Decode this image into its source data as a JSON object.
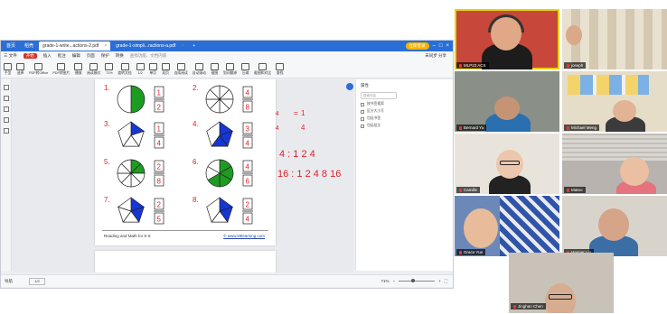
{
  "app": {
    "tabs": [
      {
        "label": "首页",
        "active": false
      },
      {
        "label": "稻壳",
        "active": false
      },
      {
        "label": "grade-1-write...actions-2.pdf",
        "active": true
      },
      {
        "label": "grade-1-simpli...ractions-a.pdf",
        "active": false
      }
    ],
    "new_tab": "+",
    "login_pill": "立即登录",
    "menu": [
      "三 文件",
      "开始",
      "插入",
      "批注",
      "编辑",
      "页面",
      "保护",
      "转换",
      "查找功能、文档内容"
    ],
    "menu_active_index": 1,
    "menu_right": "未同步  分享",
    "tools": [
      "手型",
      "选择",
      "PDF转Office",
      "PDF转图片",
      "播放",
      "阅读模式",
      "旋转文档",
      "单页",
      "双页",
      "连续阅读",
      "自动滚动",
      "截图",
      "划词翻译",
      "压缩",
      "截图和对比",
      "查找",
      "缩放"
    ],
    "zoom_value": "71%",
    "page_indicator": "1/2"
  },
  "document": {
    "footer_left": "Reading and Math for K-5",
    "footer_right": "© www.k5learning.com",
    "problems": [
      {
        "num": "1.",
        "shape": "circle",
        "parts": 2,
        "shaded": 1,
        "answer_top": "1",
        "answer_bottom": "2"
      },
      {
        "num": "2.",
        "shape": "circle",
        "parts": 8,
        "shaded": 0,
        "answer_top": "4",
        "answer_bottom": "8"
      },
      {
        "num": "3.",
        "shape": "pentagon",
        "parts": 4,
        "shaded": 1,
        "answer_top": "1",
        "answer_bottom": "4"
      },
      {
        "num": "4.",
        "shape": "pentagon",
        "parts": 4,
        "shaded": 3,
        "answer_top": "3",
        "answer_bottom": "4"
      },
      {
        "num": "5.",
        "shape": "circle",
        "parts": 8,
        "shaded": 2,
        "answer_top": "2",
        "answer_bottom": "8"
      },
      {
        "num": "6.",
        "shape": "circle",
        "parts": 6,
        "shaded": 4,
        "answer_top": "4",
        "answer_bottom": "6"
      },
      {
        "num": "7.",
        "shape": "pentagon",
        "parts": 5,
        "shaded": 2,
        "answer_top": "2",
        "answer_bottom": "5"
      },
      {
        "num": "8.",
        "shape": "pentagon",
        "parts": 4,
        "shaded": 2,
        "answer_top": "2",
        "answer_bottom": "4"
      }
    ],
    "annotations": {
      "eq_left": "4 ÷ 4",
      "eq_left_bottom": "8 ÷ 4",
      "eq_right": "1",
      "eq_right_bottom": "4",
      "ratio1": "4 : 1 2 4",
      "ratio2": "16 : 1 2 4 8 16"
    }
  },
  "side_panel": {
    "title": "属性",
    "search_placeholder": "搜索内容",
    "items": [
      "按书签搜索",
      "区分大小写",
      "包括书签",
      "包括批注"
    ]
  },
  "statusbar": {
    "left": "导航",
    "page": "1/2",
    "zoom": "71%"
  },
  "participants": [
    {
      "name": "MLP23 ACS",
      "speaking": true
    },
    {
      "name": "joseph",
      "speaking": false
    },
    {
      "name": "Bernard Yu",
      "speaking": false
    },
    {
      "name": "Michael Meng",
      "speaking": false
    },
    {
      "name": "Camille",
      "speaking": false
    },
    {
      "name": "Mateo",
      "speaking": false
    },
    {
      "name": "Grace Yue",
      "speaking": false
    },
    {
      "name": "Hanner Liu",
      "speaking": false
    },
    {
      "name": "Jinghan Chen",
      "speaking": false
    }
  ],
  "colors": {
    "fill_green": "#1e9c22",
    "fill_blue": "#1736d6",
    "ink_red": "#e0202a",
    "accent_blue": "#2b6fd6"
  }
}
